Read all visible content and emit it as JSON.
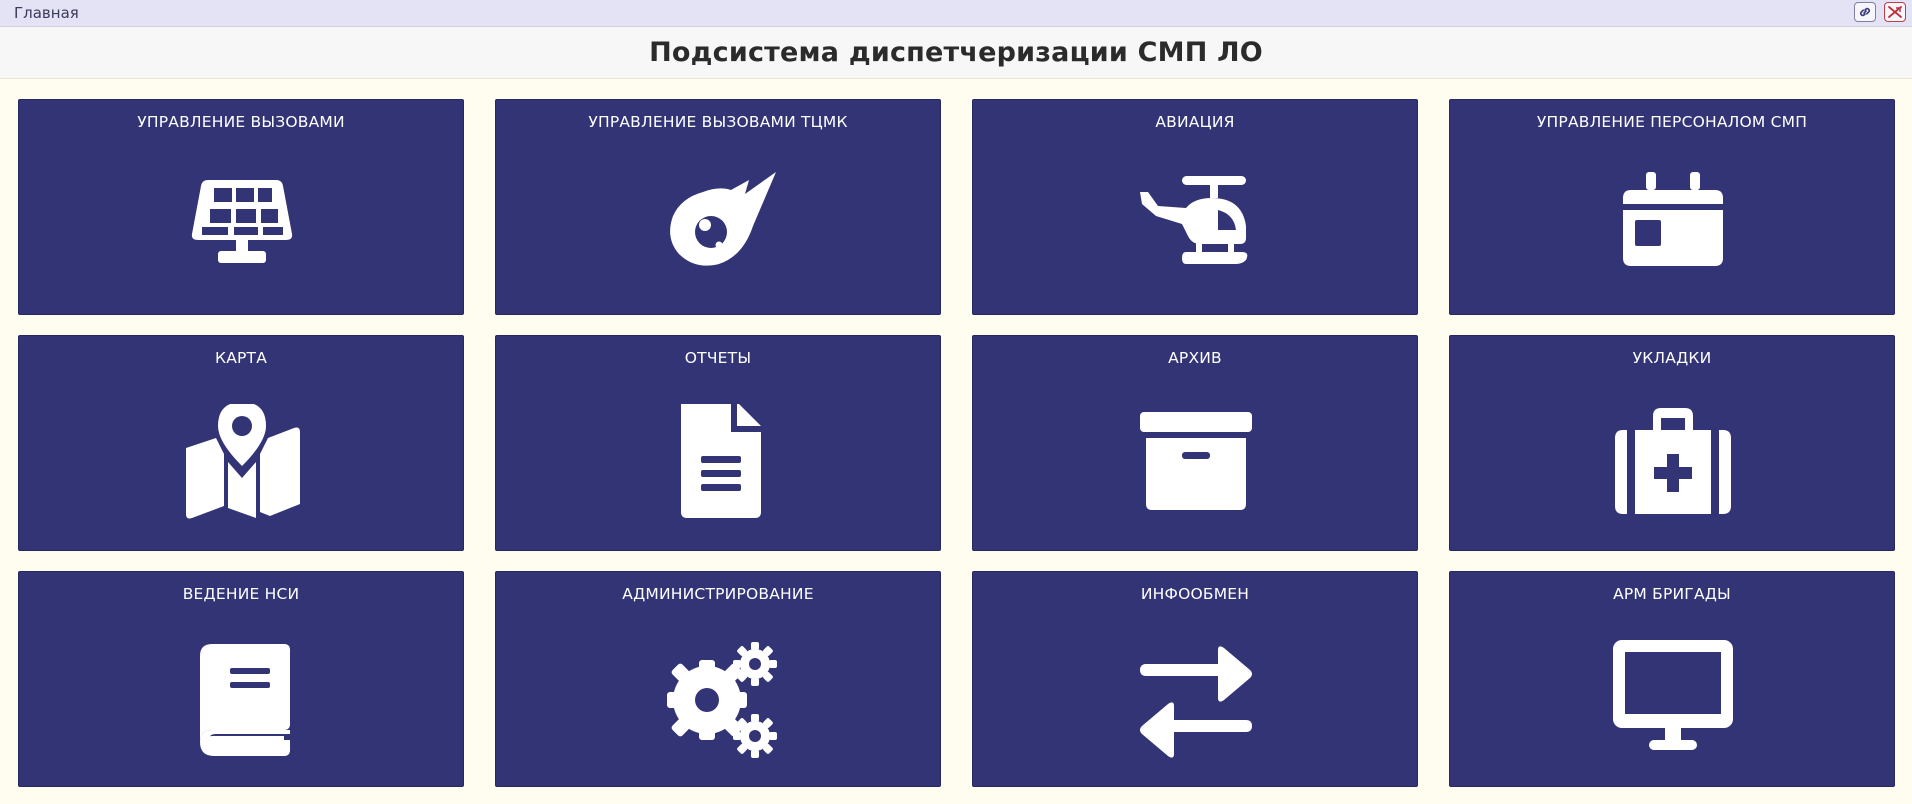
{
  "breadcrumb": "Главная",
  "header": {
    "title": "Подсистема диспетчеризации СМП ЛО"
  },
  "toolbar": {
    "link_icon": "link-icon",
    "close_icon": "exit-icon"
  },
  "colors": {
    "tile_bg": "#323475",
    "page_bg": "#fefdf0",
    "topbar_bg": "#e4e3f5"
  },
  "tiles": [
    {
      "label": "УПРАВЛЕНИЕ ВЫЗОВАМИ",
      "icon": "solar-panel-icon"
    },
    {
      "label": "УПРАВЛЕНИЕ ВЫЗОВАМИ ТЦМК",
      "icon": "meteor-icon"
    },
    {
      "label": "АВИАЦИЯ",
      "icon": "helicopter-icon"
    },
    {
      "label": "УПРАВЛЕНИЕ ПЕРСОНАЛОМ СМП",
      "icon": "calendar-day-icon"
    },
    {
      "label": "КАРТА",
      "icon": "map-location-icon"
    },
    {
      "label": "ОТЧЕТЫ",
      "icon": "file-lines-icon"
    },
    {
      "label": "АРХИВ",
      "icon": "box-archive-icon"
    },
    {
      "label": "УКЛАДКИ",
      "icon": "medical-kit-icon"
    },
    {
      "label": "ВЕДЕНИЕ НСИ",
      "icon": "book-icon"
    },
    {
      "label": "АДМИНИСТРИРОВАНИЕ",
      "icon": "gears-icon"
    },
    {
      "label": "ИНФООБМЕН",
      "icon": "right-left-arrows-icon"
    },
    {
      "label": "АРМ БРИГАДЫ",
      "icon": "desktop-icon"
    }
  ]
}
